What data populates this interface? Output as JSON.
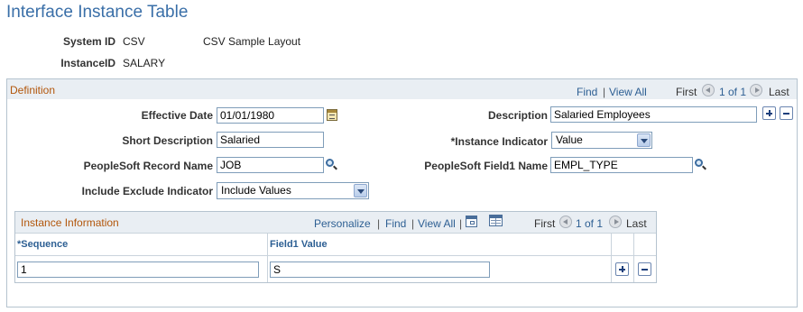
{
  "page": {
    "title": "Interface Instance Table",
    "system_id_label": "System ID",
    "system_id_value": "CSV",
    "system_id_desc": "CSV Sample Layout",
    "instance_id_label": "InstanceID",
    "instance_id_value": "SALARY"
  },
  "definition": {
    "title": "Definition",
    "find": "Find",
    "view_all": "View All",
    "first": "First",
    "counter": "1 of 1",
    "last": "Last",
    "effective_date_label": "Effective Date",
    "effective_date_value": "01/01/1980",
    "description_label": "Description",
    "description_value": "Salaried Employees",
    "short_description_label": "Short Description",
    "short_description_value": "Salaried",
    "instance_indicator_label": "*Instance Indicator",
    "instance_indicator_value": "Value",
    "record_name_label": "PeopleSoft Record Name",
    "record_name_value": "JOB",
    "field1_name_label": "PeopleSoft Field1 Name",
    "field1_name_value": "EMPL_TYPE",
    "include_exclude_label": "Include Exclude Indicator",
    "include_exclude_value": "Include Values"
  },
  "instance_info": {
    "title": "Instance Information",
    "personalize": "Personalize",
    "find": "Find",
    "view_all": "View All",
    "first": "First",
    "counter": "1 of 1",
    "last": "Last",
    "columns": [
      "*Sequence",
      "Field1 Value"
    ],
    "rows": [
      {
        "sequence": "1",
        "field1_value": "S"
      }
    ]
  },
  "icons": {
    "calendar": "calendar-icon",
    "lookup": "magnifier-icon",
    "zoom": "new-window-icon",
    "download": "grid-download-icon"
  }
}
